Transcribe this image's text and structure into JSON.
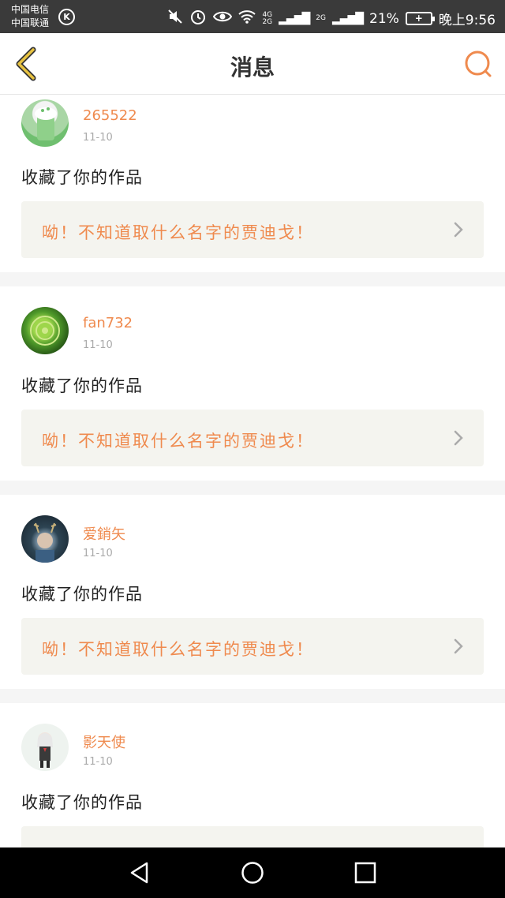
{
  "status_bar": {
    "carrier_1": "中国电信",
    "carrier_2": "中国联通",
    "k_badge": "K",
    "network_top": "4G",
    "network_bottom": "2G",
    "network_2": "2G",
    "battery_pct": "21%",
    "battery_icon_text": "+",
    "time": "晚上9:56"
  },
  "header": {
    "title": "消息"
  },
  "messages": [
    {
      "username": "265522",
      "date": "11-10",
      "action": "收藏了你的作品",
      "work_title": "呦！不知道取什么名字的贾迪戈！",
      "avatar": "green-drink-avatar"
    },
    {
      "username": "fan732",
      "date": "11-10",
      "action": "收藏了你的作品",
      "work_title": "呦！不知道取什么名字的贾迪戈！",
      "avatar": "green-rose-avatar"
    },
    {
      "username": "爱銷矢",
      "date": "11-10",
      "action": "收藏了你的作品",
      "work_title": "呦！不知道取什么名字的贾迪戈！",
      "avatar": "antlers-avatar"
    },
    {
      "username": "影天使",
      "date": "11-10",
      "action": "收藏了你的作品",
      "work_title": "",
      "avatar": "anime-girl-avatar"
    }
  ],
  "colors": {
    "accent": "#ef8a4e",
    "back_arrow": "#e8c341",
    "status_bar_bg": "#3a3a3a",
    "work_box_bg": "#f4f4ef"
  },
  "icons": {
    "back": "back-arrow-icon",
    "search": "search-icon",
    "chevron": "chevron-right-icon",
    "nav_back": "nav-back-icon",
    "nav_home": "nav-home-icon",
    "nav_recents": "nav-recents-icon"
  }
}
